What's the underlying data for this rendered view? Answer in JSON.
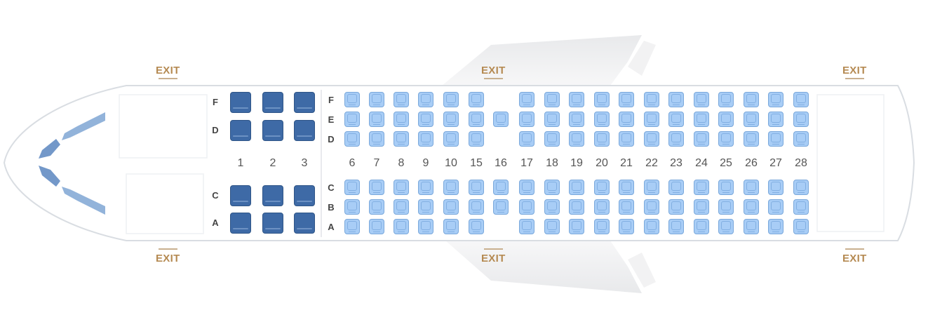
{
  "colors": {
    "business_seat": "#3e6aa6",
    "economy_seat": "#a8cdf6",
    "exit_text": "#b58a52",
    "fuselage_outline": "#d9dde2"
  },
  "exits": {
    "front_top": "EXIT",
    "front_bottom": "EXIT",
    "wing_top": "EXIT",
    "wing_bottom": "EXIT",
    "rear_top": "EXIT",
    "rear_bottom": "EXIT"
  },
  "business": {
    "rows": [
      "1",
      "2",
      "3"
    ],
    "upper_letters": [
      "F",
      "D"
    ],
    "lower_letters": [
      "C",
      "A"
    ]
  },
  "economy": {
    "rows": [
      "6",
      "7",
      "8",
      "9",
      "10",
      "15",
      "16",
      "17",
      "18",
      "19",
      "20",
      "21",
      "22",
      "23",
      "24",
      "25",
      "26",
      "27",
      "28"
    ],
    "upper_letters": [
      "F",
      "E",
      "D"
    ],
    "lower_letters": [
      "C",
      "B",
      "A"
    ],
    "row_16_seats": [
      "E",
      "C",
      "B"
    ]
  }
}
